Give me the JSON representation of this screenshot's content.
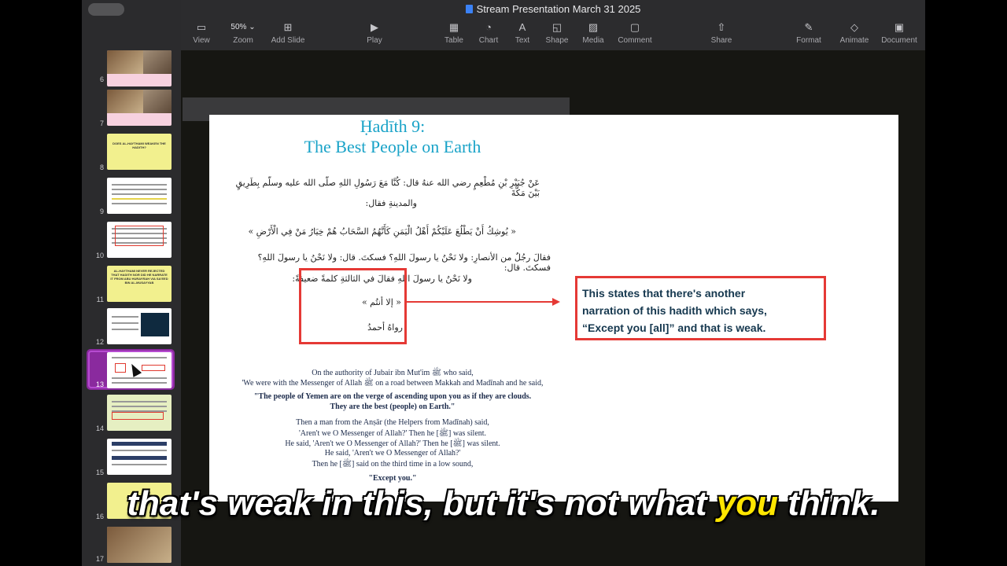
{
  "app": {
    "document_title": "Stream Presentation March 31 2025"
  },
  "toolbar": {
    "view": "View",
    "zoom_value": "50%",
    "zoom": "Zoom",
    "add_slide": "Add Slide",
    "play": "Play",
    "table": "Table",
    "chart": "Chart",
    "text": "Text",
    "shape": "Shape",
    "media": "Media",
    "comment": "Comment",
    "share": "Share",
    "format": "Format",
    "animate": "Animate",
    "document": "Document"
  },
  "sidebar": {
    "slides": [
      {
        "num": "6"
      },
      {
        "num": "7"
      },
      {
        "num": "8",
        "text": "DOES AL-HAYTHAMI WEAKEN THE HADITH?"
      },
      {
        "num": "9"
      },
      {
        "num": "10"
      },
      {
        "num": "11",
        "text": "AL-HAYTHAMI NEVER REJECTED THAT HADITH NOR DID HE NARRATE IT FROM ABU HURAYRAH VIA SA'EED BIN AL-MUSAYYAB"
      },
      {
        "num": "12"
      },
      {
        "num": "13"
      },
      {
        "num": "14"
      },
      {
        "num": "15"
      },
      {
        "num": "16"
      },
      {
        "num": "17"
      }
    ],
    "selected": "13"
  },
  "slide": {
    "title_line1": "Ḥadīth 9:",
    "title_line2": "The Best People on Earth",
    "arabic": [
      "عَنْ جُبَيْرِ بْنِ مُطْعِمٍ رضي الله عنهُ قال: كُنَّا مَعَ رَسُولِ اللهِ صلّى الله عليه وسلّم بِطَرِيقٍ بَيْنَ مَكَّةَ",
      "والمدينةِ فقال:",
      "« يُوشِكُ أَنْ يَطْلُعَ عَلَيْكُمْ أَهْلُ الْيَمَنِ كَأَنَّهُمُ السَّحَابُ هُمْ خِيَارُ مَنْ فِي الْأَرْضِ »",
      "فقالَ رجُلٌ من الأنصارِ: ولا نَحْنُ يا رسولَ اللهِ؟ فسكتَ. قال: ولا نَحْنُ يا رسولَ اللهِ؟ فسكتَ. قال:",
      "ولا نَحْنُ يا رسولَ اللهِ فقالَ في الثالثةِ كلمةً ضعيفةً:",
      "« إلا أنتُم »",
      "رواهُ أحمدُ"
    ],
    "english": [
      "On the authority of Jubair ibn Mut'im ﷺ who said,",
      "'We were with the Messenger of Allah ﷺ on a road between Makkah and Madīnah and he said,",
      "\"The people of Yemen are on the verge of ascending upon you as if they are clouds.",
      "They are the best (people) on Earth.\"",
      "Then a man from the Anṣār (the Helpers from Madīnah) said,",
      "'Aren't we O Messenger of Allah?' Then he [ﷺ] was silent.",
      "He said, 'Aren't we O Messenger of Allah?' Then he [ﷺ] was silent.",
      "He said, 'Aren't we O Messenger of Allah?'",
      "Then he [ﷺ] said on the third time in a low sound,",
      "\"Except you.\""
    ],
    "note_lines": [
      "This states that there's another",
      "narration of this hadith which says,",
      "“Except you [all]” and that is weak."
    ]
  },
  "subtitle": {
    "before": "that's weak in this, but it's not what ",
    "highlight": "you",
    "after": " think."
  },
  "colors": {
    "accent_title": "#1aa3c8",
    "annotation_red": "#e53935",
    "selection_purple": "#8a2a9e",
    "subtitle_highlight": "#ffe600"
  }
}
